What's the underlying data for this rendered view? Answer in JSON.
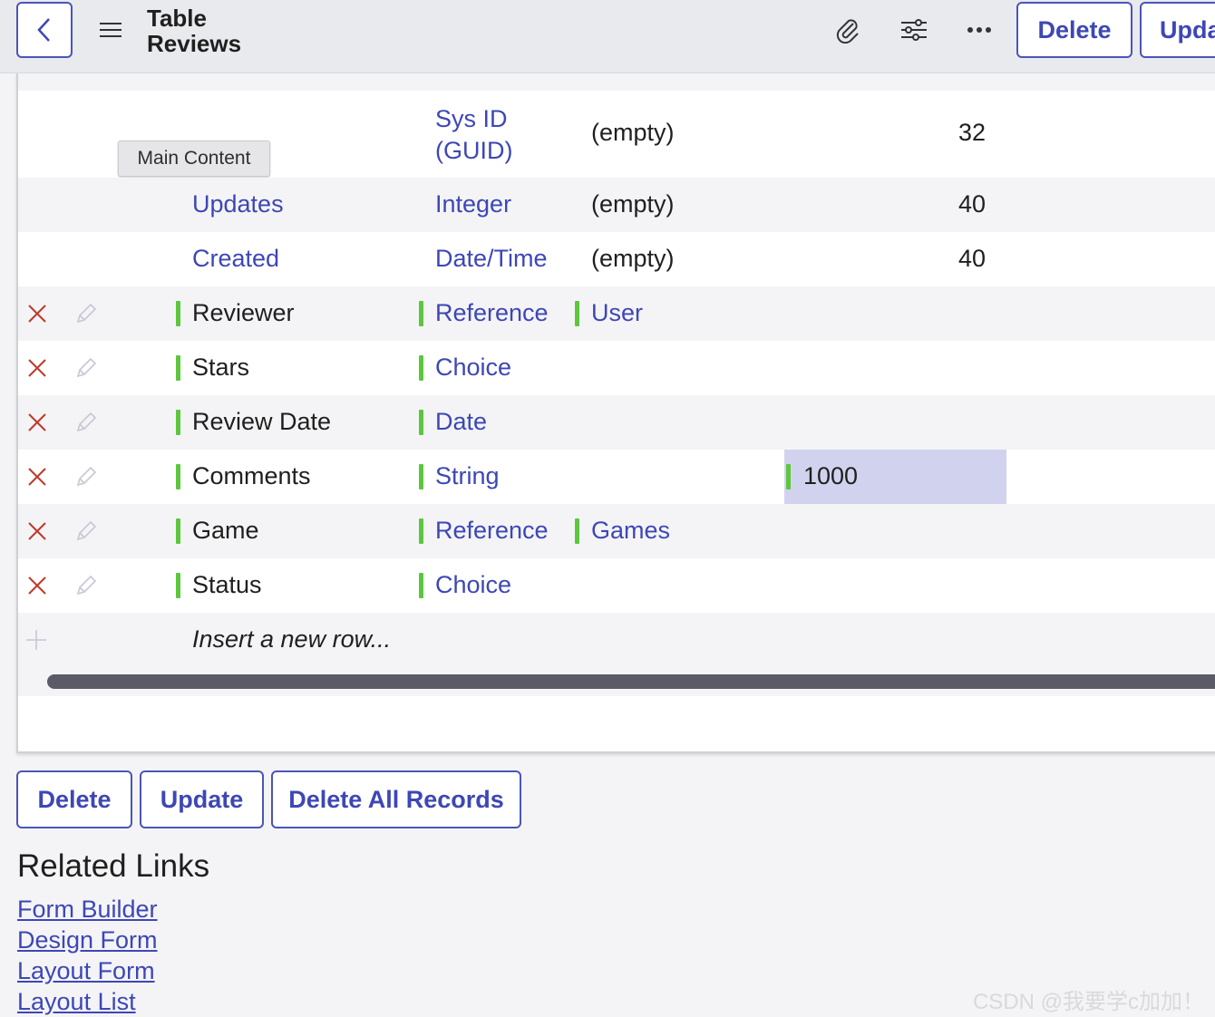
{
  "header": {
    "title_line1": "Table",
    "title_line2": "Reviews",
    "delete_label": "Delete",
    "update_label": "Upda"
  },
  "tooltip": "Main Content",
  "partial_rows": [
    {
      "type": "Sys ID\n(GUID)",
      "reference": "(empty)",
      "max_length": "32"
    },
    {
      "column": "Updates",
      "type": "Integer",
      "reference": "(empty)",
      "max_length": "40"
    },
    {
      "column": "Created",
      "type": "Date/Time",
      "reference": "(empty)",
      "max_length": "40"
    }
  ],
  "rows": [
    {
      "column": "Reviewer",
      "type": "Reference",
      "reference": "User",
      "max_length": ""
    },
    {
      "column": "Stars",
      "type": "Choice",
      "reference": "",
      "max_length": ""
    },
    {
      "column": "Review Date",
      "type": "Date",
      "reference": "",
      "max_length": ""
    },
    {
      "column": "Comments",
      "type": "String",
      "reference": "",
      "max_length": "1000"
    },
    {
      "column": "Game",
      "type": "Reference",
      "reference": "Games",
      "max_length": ""
    },
    {
      "column": "Status",
      "type": "Choice",
      "reference": "",
      "max_length": ""
    }
  ],
  "insert_row": "Insert a new row...",
  "buttons": {
    "delete": "Delete",
    "update": "Update",
    "delete_all": "Delete All Records"
  },
  "related": {
    "title": "Related Links",
    "links": [
      "Form Builder",
      "Design Form",
      "Layout Form",
      "Layout List"
    ]
  },
  "watermark": "CSDN @我要学c加加！",
  "colors": {
    "accent": "#3d47b5",
    "green_bar": "#5cc73e",
    "delete_x": "#c0392b",
    "highlight": "#d1d3ee"
  },
  "icons": [
    "chevron-left-icon",
    "hamburger-icon",
    "paperclip-icon",
    "sliders-icon",
    "more-icon",
    "close-icon",
    "pencil-icon",
    "plus-icon"
  ]
}
